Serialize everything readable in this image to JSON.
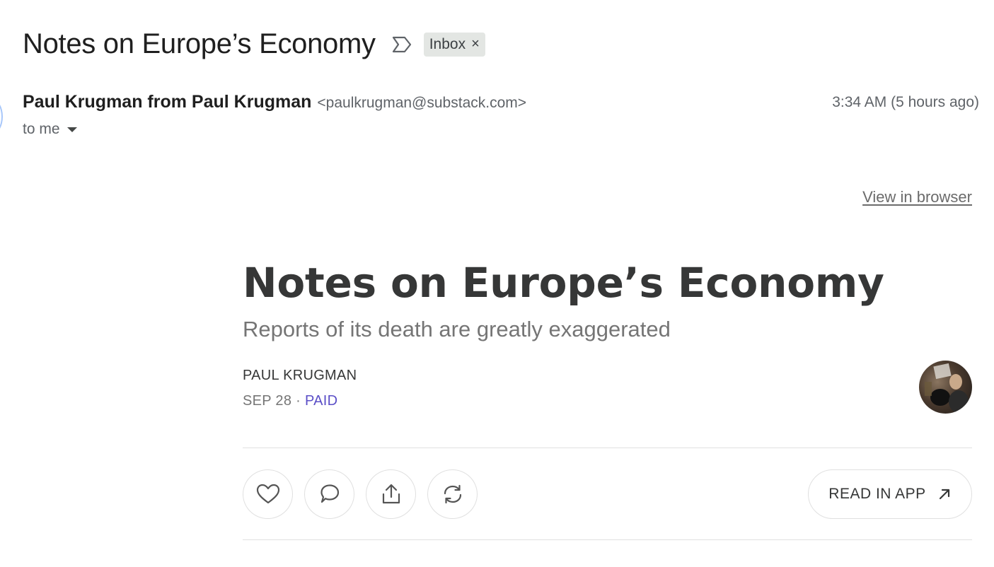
{
  "email": {
    "subject": "Notes on Europe’s Economy",
    "label": "Inbox",
    "label_close": "×",
    "sender_name": "Paul Krugman from Paul Krugman",
    "sender_email": "<paulkrugman@substack.com>",
    "timestamp": "3:34 AM (5 hours ago)",
    "recipient": "to me",
    "view_in_browser": "View in browser"
  },
  "post": {
    "title": "Notes on Europe’s Economy",
    "subtitle": "Reports of its death are greatly exaggerated",
    "author": "PAUL KRUGMAN",
    "date": "SEP 28",
    "separator": "·",
    "access": "PAID",
    "access_color": "#5b4fc7"
  },
  "actions": {
    "icons": [
      "heart-icon",
      "comment-icon",
      "share-icon",
      "restack-icon"
    ],
    "read_in_app": "READ IN APP",
    "read_in_app_icon": "arrow-up-right-icon"
  }
}
